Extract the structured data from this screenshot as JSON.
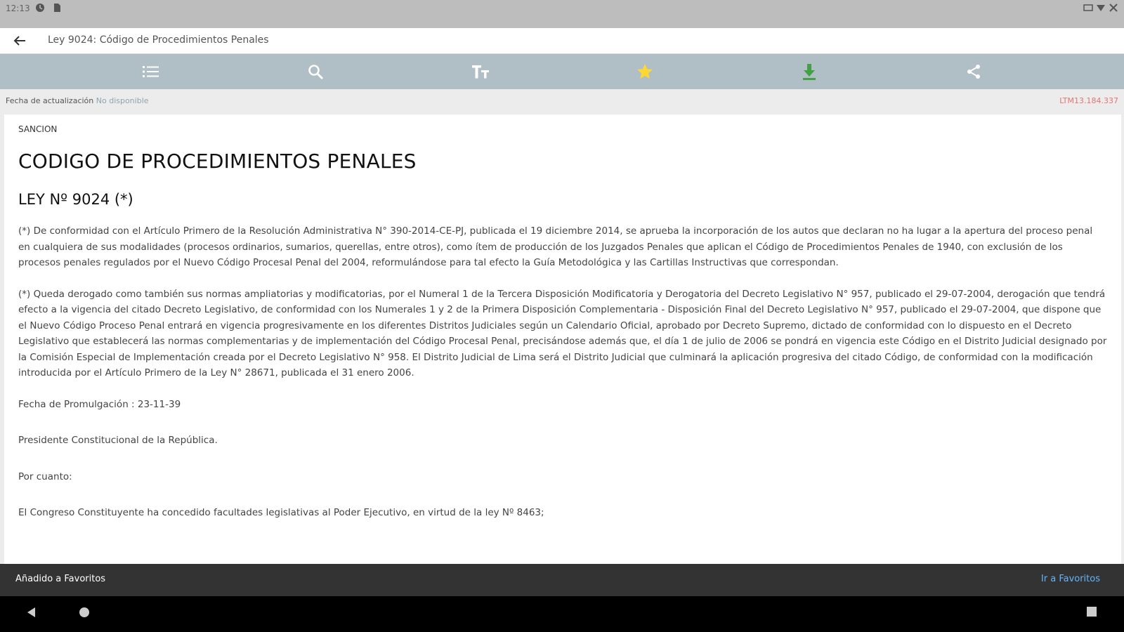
{
  "status_bar": {
    "time": "12:13"
  },
  "app_bar": {
    "title": "Ley 9024: Código de Procedimientos Penales"
  },
  "toolbar": {
    "icons": [
      "list-icon",
      "search-icon",
      "text-size-icon",
      "star-icon",
      "download-icon",
      "share-icon"
    ]
  },
  "info_bar": {
    "label": "Fecha de actualización",
    "value": "No disponible",
    "version": "LTM13.184.337"
  },
  "document": {
    "section": "SANCION",
    "title": "CODIGO DE PROCEDIMIENTOS PENALES",
    "law": "LEY Nº 9024 (*)",
    "note1": "(*) De conformidad con el Artículo Primero de la Resolución Administrativa N° 390-2014-CE-PJ, publicada el 19 diciembre 2014, se aprueba la incorporación de los autos que declaran no ha lugar a la apertura del proceso penal en cualquiera de sus modalidades (procesos ordinarios, sumarios, querellas, entre otros), como ítem de producción de los Juzgados Penales que aplican el Código de Procedimientos Penales de 1940, con exclusión de los procesos penales regulados por el Nuevo Código Procesal Penal del 2004, reformulándose para tal efecto la Guía Metodológica y las Cartillas Instructivas que correspondan.",
    "note2": "(*) Queda derogado como también sus normas ampliatorias y modificatorias, por el Numeral 1 de la Tercera Disposición Modificatoria y Derogatoria del Decreto Legislativo N° 957, publicado el 29-07-2004, derogación que tendrá efecto a la vigencia del citado Decreto Legislativo, de conformidad con los Numerales 1 y 2 de la Primera Disposición Complementaria - Disposición Final del Decreto Legislativo N° 957, publicado el 29-07-2004, que dispone que el Nuevo Código Proceso Penal entrará en vigencia progresivamente en los diferentes Distritos Judiciales según un Calendario Oficial, aprobado por Decreto Supremo, dictado de conformidad con lo dispuesto en el Decreto Legislativo que establecerá las normas complementarias y de implementación del Código Procesal Penal, precisándose además que, el día 1 de julio de 2006 se pondrá en vigencia este Código en el Distrito Judicial designado por la Comisión Especial de Implementación creada por el Decreto Legislativo N° 958. El Distrito Judicial de Lima será el Distrito Judicial que culminará la aplicación progresiva del citado Código, de conformidad con la modificación introducida por el Artículo Primero de la Ley N° 28671, publicada el 31 enero 2006.",
    "promulgation": "Fecha de Promulgación : 23-11-39",
    "p1": "Presidente Constitucional de la República.",
    "p2": "Por cuanto:",
    "p3": "El Congreso Constituyente ha concedido facultades legislativas al Poder Ejecutivo, en virtud de la ley Nº 8463;"
  },
  "snackbar": {
    "message": "Añadido a Favoritos",
    "action": "Ir a Favoritos"
  },
  "colors": {
    "toolbar": "#b0bec5",
    "star": "#fdd835",
    "download": "#43a047",
    "version": "#e57373",
    "snack_action": "#64b5f6"
  }
}
